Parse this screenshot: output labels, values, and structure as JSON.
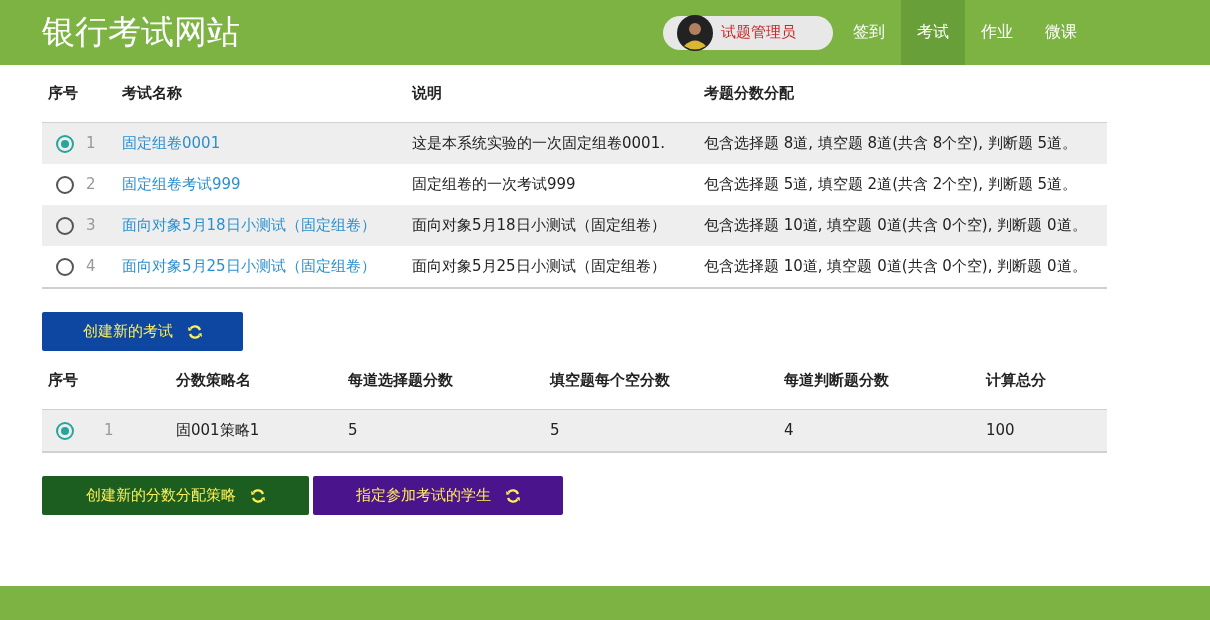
{
  "header": {
    "title": "银行考试网站",
    "user": {
      "name": "试题管理员"
    },
    "nav": [
      {
        "label": "签到",
        "selected": false
      },
      {
        "label": "考试",
        "selected": true
      },
      {
        "label": "作业",
        "selected": false
      },
      {
        "label": "微课",
        "selected": false
      }
    ]
  },
  "exam_table": {
    "columns": [
      "序号",
      "考试名称",
      "说明",
      "考题分数分配"
    ],
    "rows": [
      {
        "selected": true,
        "index": "1",
        "name": "固定组卷0001",
        "description": "这是本系统实验的一次固定组卷0001.",
        "allocation": "包含选择题 8道, 填空题 8道(共含 8个空), 判断题 5道。"
      },
      {
        "selected": false,
        "index": "2",
        "name": "固定组卷考试999",
        "description": "固定组卷的一次考试999",
        "allocation": "包含选择题 5道, 填空题 2道(共含 2个空), 判断题 5道。"
      },
      {
        "selected": false,
        "index": "3",
        "name": "面向对象5月18日小测试（固定组卷）",
        "description": "面向对象5月18日小测试（固定组卷）",
        "allocation": "包含选择题 10道, 填空题 0道(共含 0个空), 判断题 0道。"
      },
      {
        "selected": false,
        "index": "4",
        "name": "面向对象5月25日小测试（固定组卷）",
        "description": "面向对象5月25日小测试（固定组卷）",
        "allocation": "包含选择题 10道, 填空题 0道(共含 0个空), 判断题 0道。"
      }
    ]
  },
  "create_exam_button": {
    "label": "创建新的考试",
    "color": "#0d47a1"
  },
  "strategy_table": {
    "columns": [
      "序号",
      "分数策略名",
      "每道选择题分数",
      "填空题每个空分数",
      "每道判断题分数",
      "计算总分"
    ],
    "rows": [
      {
        "selected": true,
        "cells": [
          "1",
          "固001策略1",
          "5",
          "5",
          "4",
          "100"
        ]
      }
    ]
  },
  "buttons": [
    {
      "label": "创建新的分数分配策略",
      "color": "#1b5e20"
    },
    {
      "label": "指定参加考试的学生",
      "color": "#4a148c"
    }
  ]
}
